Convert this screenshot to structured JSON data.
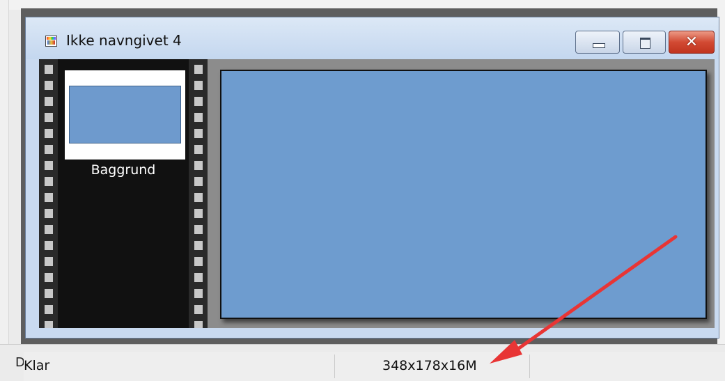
{
  "window": {
    "title": "Ikke navngivet 4",
    "controls": {
      "minimize": "minimize",
      "maximize": "maximize",
      "close": "✕"
    }
  },
  "layers": [
    {
      "label": "Baggrund"
    }
  ],
  "canvas": {
    "fill_color": "#6e9ccf"
  },
  "status_bar": {
    "left_glyph": "D",
    "message": "Klar",
    "image_info": "348x178x16M"
  },
  "annotation": {
    "arrow_color": "#e83535"
  }
}
